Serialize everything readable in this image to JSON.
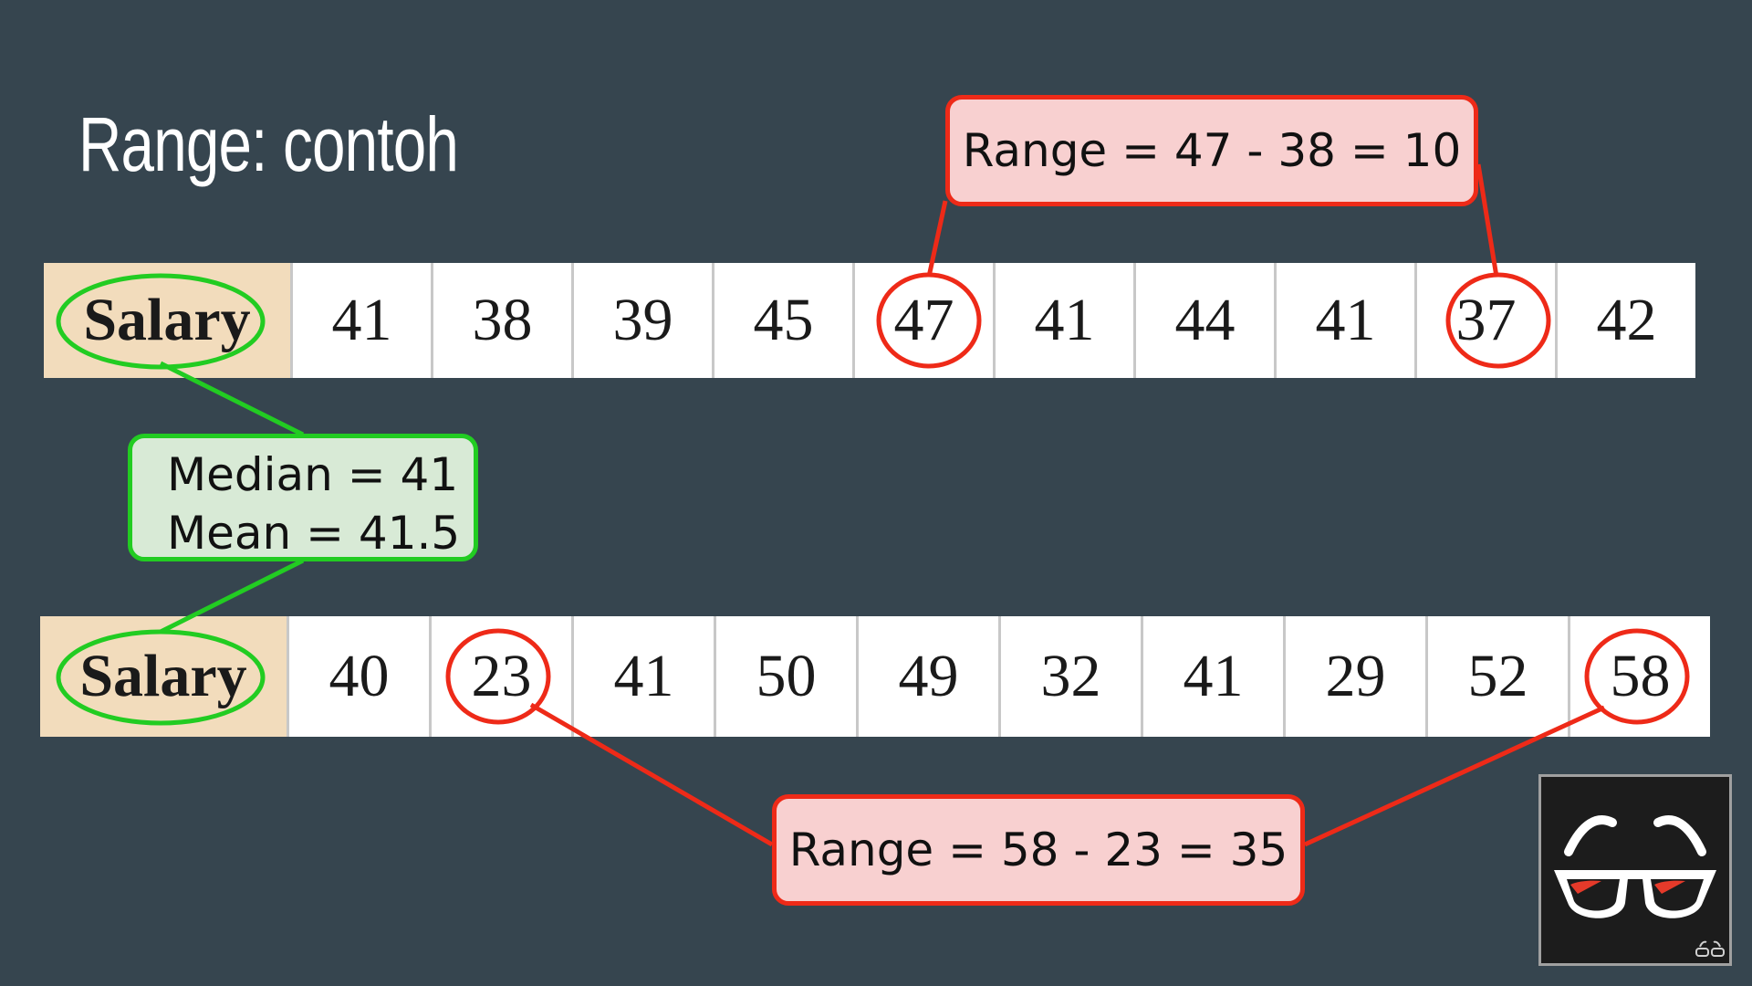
{
  "title": "Range: contoh",
  "table1": {
    "header": "Salary",
    "values": [
      "41",
      "38",
      "39",
      "45",
      "47",
      "41",
      "44",
      "41",
      "37",
      "42"
    ]
  },
  "table2": {
    "header": "Salary",
    "values": [
      "40",
      "23",
      "41",
      "50",
      "49",
      "32",
      "41",
      "29",
      "52",
      "58"
    ]
  },
  "callout_top": "Range = 47 - 38 = 10",
  "callout_bottom": "Range = 58 - 23 = 35",
  "stats": {
    "median": "Median = 41",
    "mean": "Mean = 41.5"
  },
  "colors": {
    "background": "#36454f",
    "highlight_red": "#ee2a18",
    "highlight_green": "#22cc22",
    "callout_red_fill": "#f8d0d0",
    "callout_green_fill": "#d8ead6",
    "header_fill": "#f2dcbc"
  },
  "icons": {
    "logo": "glasses-icon"
  }
}
